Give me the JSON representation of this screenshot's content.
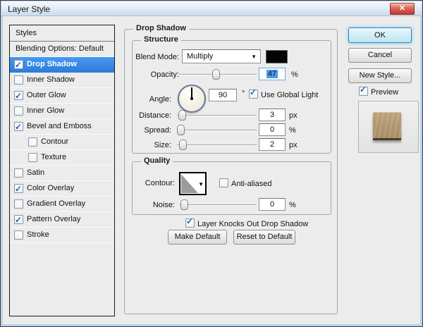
{
  "window": {
    "title": "Layer Style"
  },
  "icons": {
    "close": "✕",
    "check": "✓",
    "dropdown_arrow": "▼"
  },
  "sidebar": {
    "header": "Styles",
    "items": [
      {
        "label": "Blending Options: Default",
        "has_checkbox": false,
        "checked": false,
        "selected": false
      },
      {
        "label": "Drop Shadow",
        "has_checkbox": true,
        "checked": true,
        "selected": true
      },
      {
        "label": "Inner Shadow",
        "has_checkbox": true,
        "checked": false,
        "selected": false
      },
      {
        "label": "Outer Glow",
        "has_checkbox": true,
        "checked": true,
        "selected": false
      },
      {
        "label": "Inner Glow",
        "has_checkbox": true,
        "checked": false,
        "selected": false
      },
      {
        "label": "Bevel and Emboss",
        "has_checkbox": true,
        "checked": true,
        "selected": false
      },
      {
        "label": "Contour",
        "has_checkbox": true,
        "checked": false,
        "selected": false,
        "indent": true
      },
      {
        "label": "Texture",
        "has_checkbox": true,
        "checked": false,
        "selected": false,
        "indent": true
      },
      {
        "label": "Satin",
        "has_checkbox": true,
        "checked": false,
        "selected": false
      },
      {
        "label": "Color Overlay",
        "has_checkbox": true,
        "checked": true,
        "selected": false
      },
      {
        "label": "Gradient Overlay",
        "has_checkbox": true,
        "checked": false,
        "selected": false
      },
      {
        "label": "Pattern Overlay",
        "has_checkbox": true,
        "checked": true,
        "selected": false
      },
      {
        "label": "Stroke",
        "has_checkbox": true,
        "checked": false,
        "selected": false
      }
    ]
  },
  "panel": {
    "title": "Drop Shadow",
    "structure": {
      "title": "Structure",
      "blend_mode": {
        "label": "Blend Mode:",
        "value": "Multiply",
        "swatch_color": "#000000"
      },
      "opacity": {
        "label": "Opacity:",
        "value": "47",
        "unit": "%",
        "selected": true
      },
      "angle": {
        "label": "Angle:",
        "value": "90",
        "unit": "°",
        "use_global_light": {
          "label": "Use Global Light",
          "checked": true
        }
      },
      "distance": {
        "label": "Distance:",
        "value": "3",
        "unit": "px"
      },
      "spread": {
        "label": "Spread:",
        "value": "0",
        "unit": "%"
      },
      "size": {
        "label": "Size:",
        "value": "2",
        "unit": "px"
      }
    },
    "quality": {
      "title": "Quality",
      "contour": {
        "label": "Contour:"
      },
      "anti_aliased": {
        "label": "Anti-aliased",
        "checked": false
      },
      "noise": {
        "label": "Noise:",
        "value": "0",
        "unit": "%"
      }
    },
    "knockout": {
      "label": "Layer Knocks Out Drop Shadow",
      "checked": true
    },
    "footer_buttons": {
      "make_default": "Make Default",
      "reset_to_default": "Reset to Default"
    }
  },
  "actions": {
    "ok": "OK",
    "cancel": "Cancel",
    "new_style": "New Style...",
    "preview": {
      "label": "Preview",
      "checked": true
    }
  }
}
